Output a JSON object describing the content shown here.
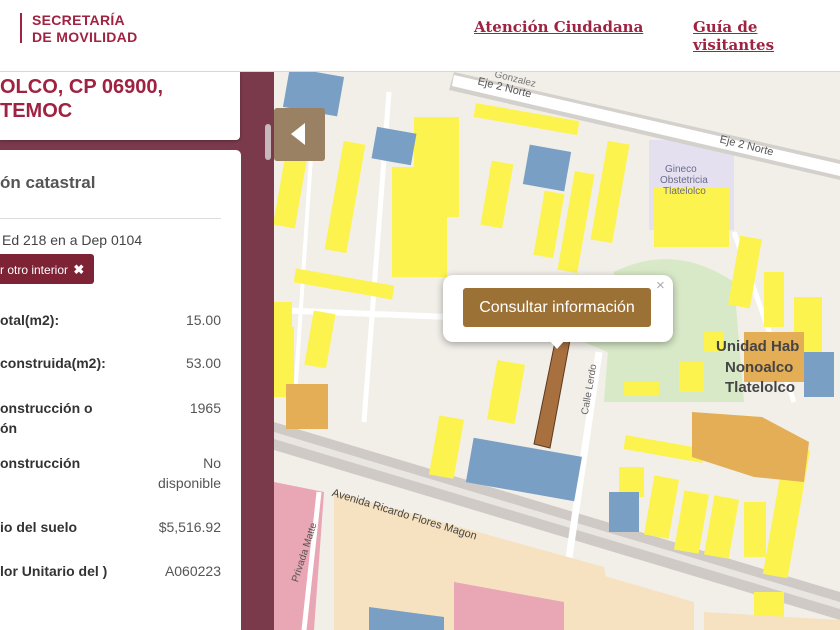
{
  "header": {
    "logo_line1": "SECRETARÍA",
    "logo_line2": "DE MOVILIDAD",
    "nav": [
      "Atención Ciudadana",
      "Guía de visitantes"
    ]
  },
  "address": {
    "line1": "OLCO, CP 06900,",
    "line2": "TEMOC"
  },
  "panel": {
    "title": "ón catastral",
    "unit": "Ed 218 en a Dep 0104",
    "other_button": "r otro interior",
    "other_button_icon": "✖",
    "rows": [
      {
        "label": "otal(m2):",
        "value": "15.00"
      },
      {
        "label": "construida(m2):",
        "value": "53.00"
      },
      {
        "label": "onstrucción o ón",
        "value": "1965"
      },
      {
        "label": "onstrucción",
        "value": "No disponible"
      },
      {
        "label": "io del suelo",
        "value": "$5,516.92"
      },
      {
        "label": "lor Unitario del )",
        "value": "A060223"
      }
    ]
  },
  "map": {
    "labels": {
      "eje2_norte_a": "Eje 2 Norte",
      "eje2_norte_b": "Eje 2 Norte",
      "gonzalez": "Gonzalez",
      "gineco1": "Gineco",
      "gineco2": "Obstetricia",
      "gineco3": "Tlatelolco",
      "unidad1": "Unidad Hab",
      "unidad2": "Nonoalco",
      "unidad3": "Tlatelolco",
      "calle_lerdo": "Calle Lerdo",
      "avenida": "Avenida Ricardo Flores Magon",
      "privada": "Privada Matte"
    },
    "popup_button": "Consultar información",
    "popup_close": "×",
    "colors": {
      "building_yellow": "#fcf34f",
      "building_blue": "#7a9fc4",
      "building_orange": "#e3ae56",
      "building_pink": "#e9a6b5",
      "selected_parcel": "#a8703f",
      "park": "#d7e9c7"
    }
  }
}
